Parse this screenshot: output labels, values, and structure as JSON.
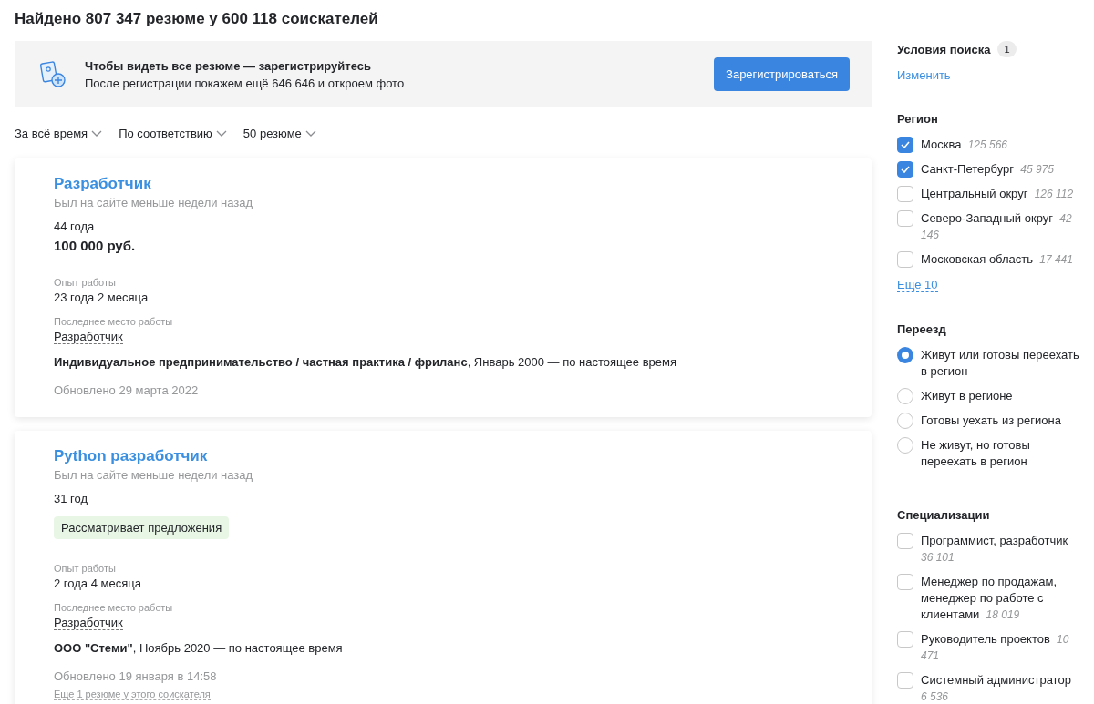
{
  "heading": "Найдено 807 347 резюме у 600 118 соискателей",
  "banner": {
    "title": "Чтобы видеть все резюме — зарегистрируйтесь",
    "text": "После регистрации покажем ещё 646 646 и откроем фото",
    "button": "Зарегистрироваться"
  },
  "sort_controls": [
    "За всё время",
    "По соответствию",
    "50 резюме"
  ],
  "resumes": [
    {
      "title": "Разработчик",
      "last_seen": "Был на сайте меньше недели назад",
      "age": "44 года",
      "salary": "100 000 руб.",
      "experience_label": "Опыт работы",
      "experience": "23 года 2 месяца",
      "last_job_label": "Последнее место работы",
      "last_job": "Разработчик",
      "company_line": "**Индивидуальное предпринимательство / частная практика / фриланс**, Январь 2000 — по настоящее время",
      "updated": "Обновлено 29 марта 2022"
    },
    {
      "title": "Python разработчик",
      "last_seen": "Был на сайте меньше недели назад",
      "age": "31 год",
      "status_tag": "Рассматривает предложения",
      "experience_label": "Опыт работы",
      "experience": "2 года 4 месяца",
      "last_job_label": "Последнее место работы",
      "last_job": "Разработчик",
      "company_line": "**ООО \"Стеми\"**, Ноябрь 2020 — по настоящее время",
      "updated": "Обновлено 19 января в 14:58",
      "more_link": "Еще 1 резюме у этого соискателя"
    }
  ],
  "sidebar": {
    "conditions_title": "Условия поиска",
    "conditions_count": "1",
    "change_link": "Изменить",
    "groups": [
      {
        "kind": "checkbox",
        "title": "Регион",
        "items": [
          {
            "label": "Москва",
            "count": "125 566",
            "checked": true
          },
          {
            "label": "Санкт-Петербург",
            "count": "45 975",
            "checked": true
          },
          {
            "label": "Центральный округ",
            "count": "126 112",
            "checked": false
          },
          {
            "label": "Северо-Западный округ",
            "count": "42 146",
            "checked": false
          },
          {
            "label": "Московская область",
            "count": "17 441",
            "checked": false
          }
        ],
        "more": "Еще 10"
      },
      {
        "kind": "radio",
        "title": "Переезд",
        "items": [
          {
            "label": "Живут или готовы переехать в регион",
            "selected": true
          },
          {
            "label": "Живут в регионе",
            "selected": false
          },
          {
            "label": "Готовы уехать из региона",
            "selected": false
          },
          {
            "label": "Не живут, но готовы переехать в регион",
            "selected": false
          }
        ]
      },
      {
        "kind": "checkbox",
        "title": "Специализации",
        "items": [
          {
            "label": "Программист, разработчик",
            "count": "36 101",
            "checked": false
          },
          {
            "label": "Менеджер по продажам, менеджер по работе с клиентами",
            "count": "18 019",
            "checked": false
          },
          {
            "label": "Руководитель проектов",
            "count": "10 471",
            "checked": false
          },
          {
            "label": "Системный администратор",
            "count": "6 536",
            "checked": false
          }
        ]
      }
    ]
  }
}
